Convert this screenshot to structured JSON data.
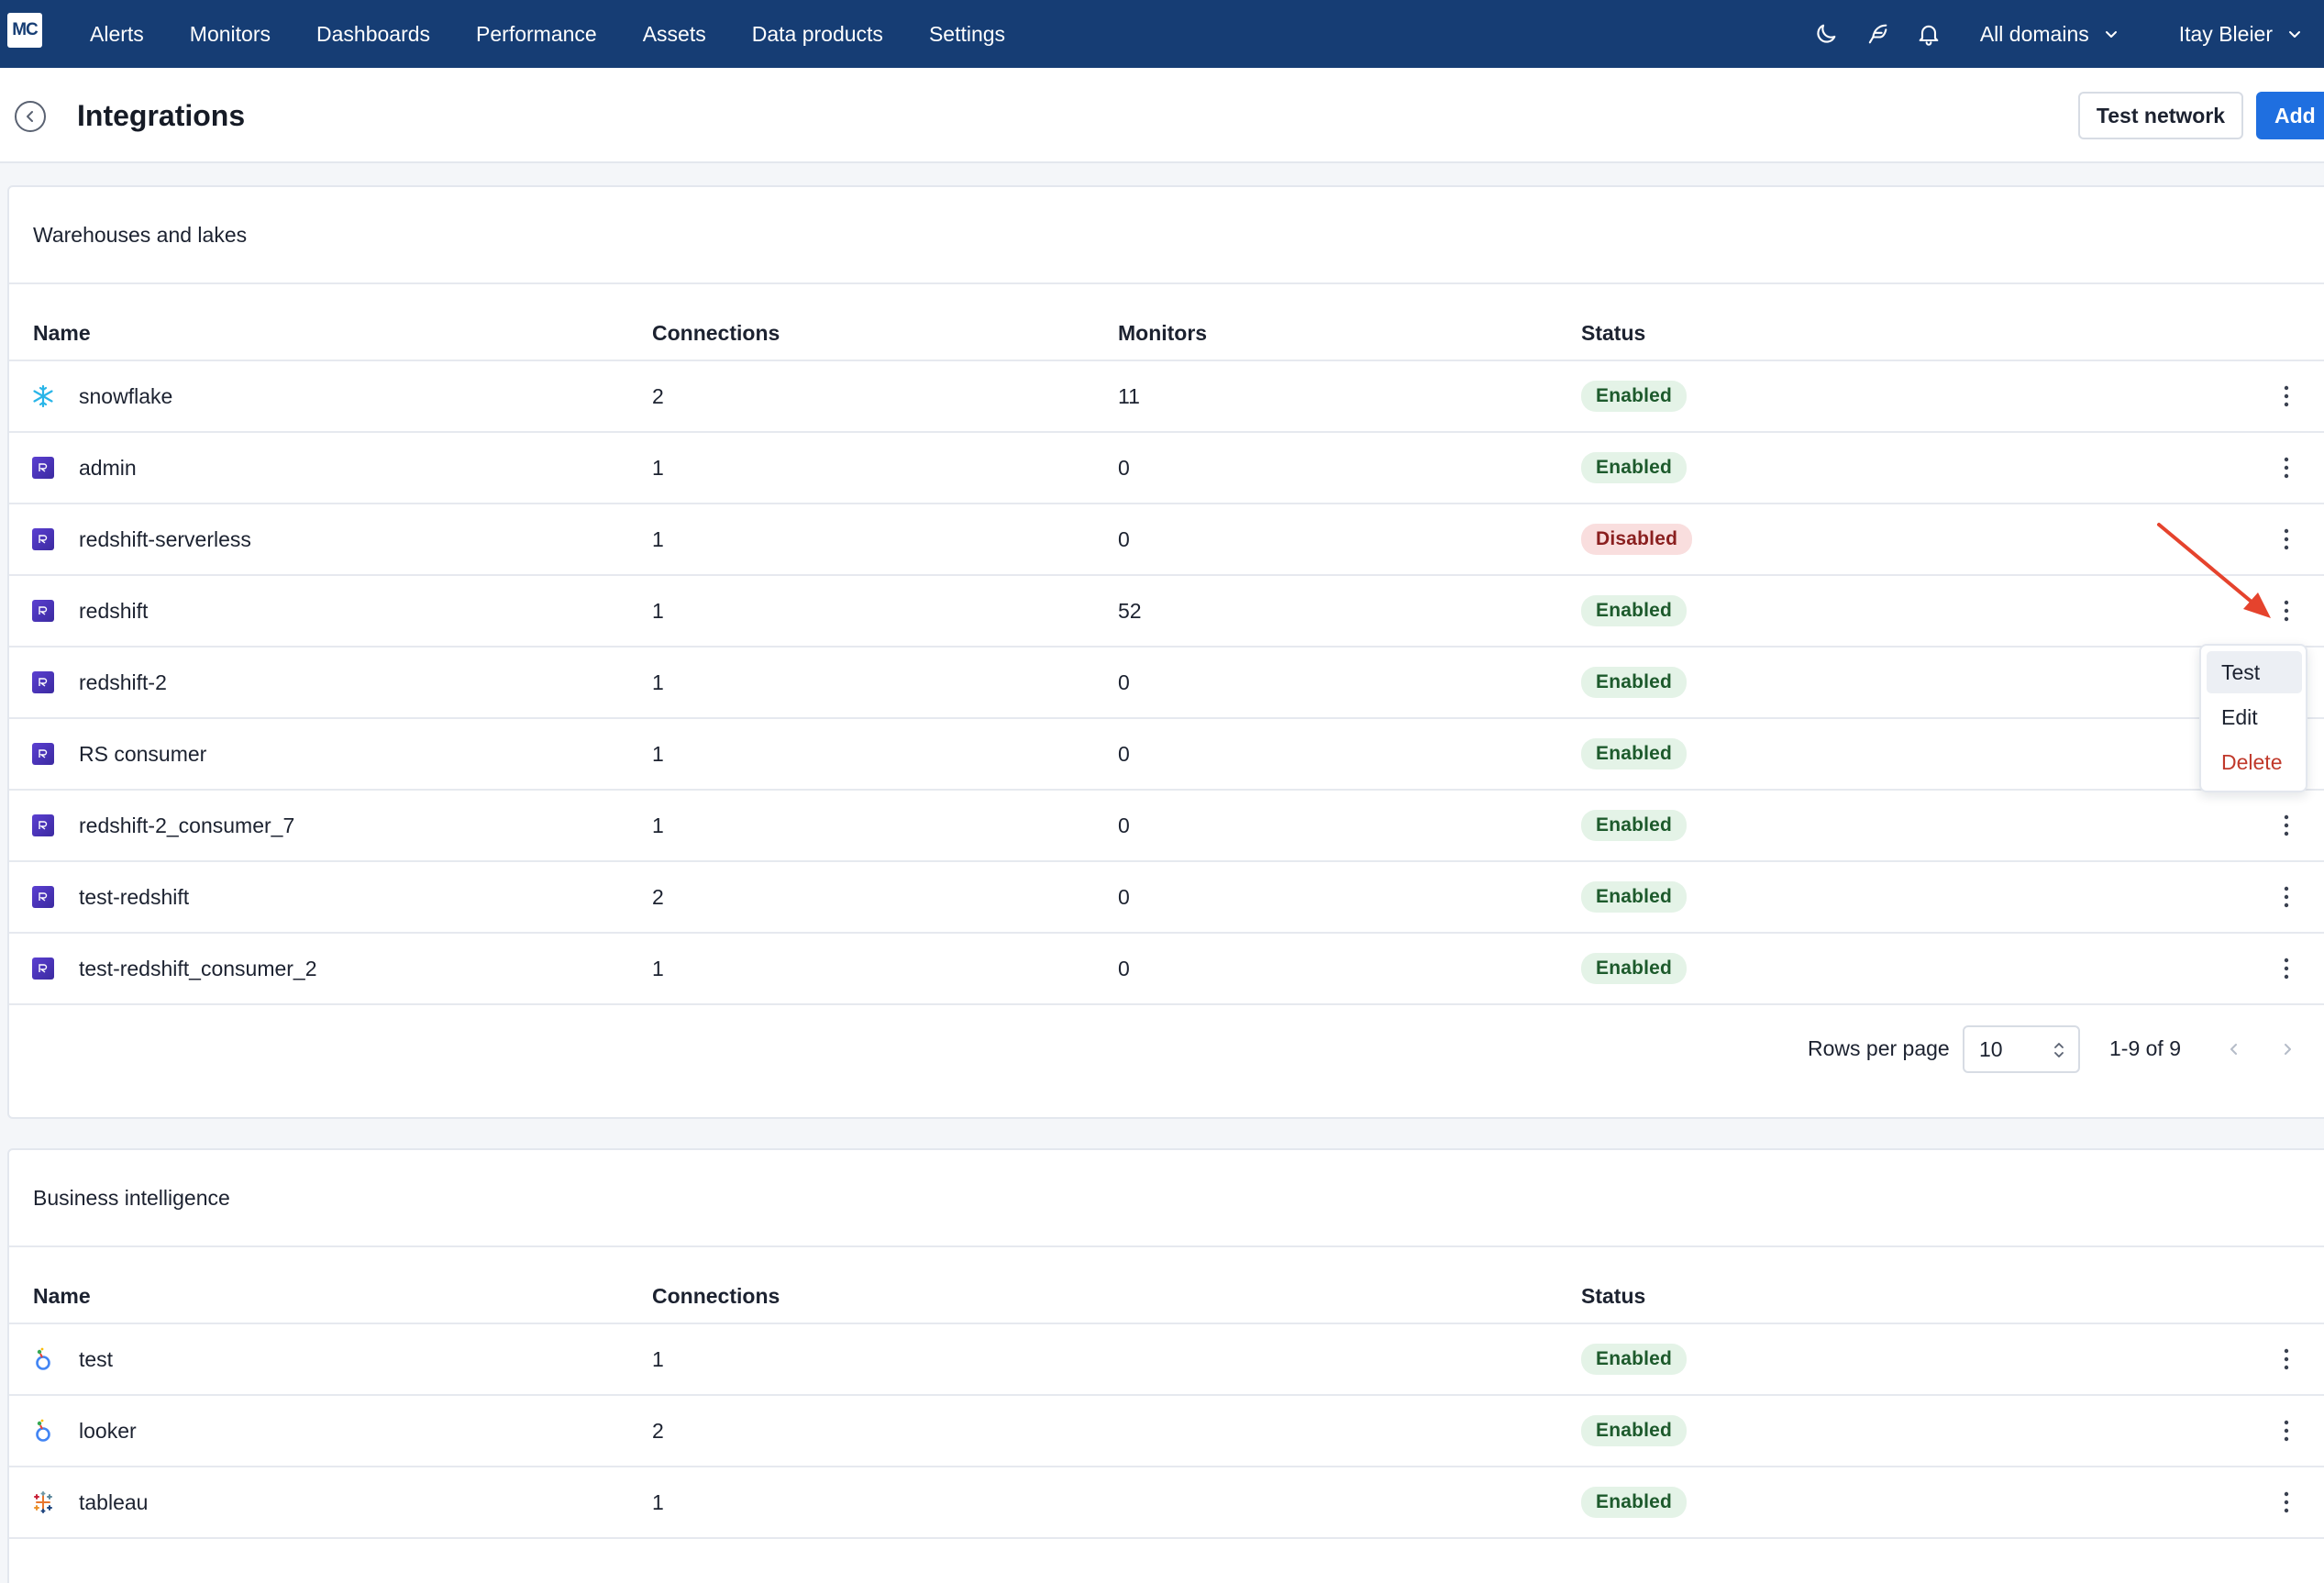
{
  "nav": {
    "logo": "MC",
    "items": [
      "Alerts",
      "Monitors",
      "Dashboards",
      "Performance",
      "Assets",
      "Data products",
      "Settings"
    ],
    "icons": [
      "moon-icon",
      "feather-icon",
      "bell-icon"
    ],
    "domain_select": "All domains",
    "user": "Itay Bleier"
  },
  "header": {
    "title": "Integrations",
    "test_network_label": "Test network",
    "add_label": "Add"
  },
  "warehouses": {
    "title": "Warehouses and lakes",
    "columns": [
      "Name",
      "Connections",
      "Monitors",
      "Status"
    ],
    "rows": [
      {
        "name": "snowflake",
        "icon": "snowflake-icon",
        "connections": "2",
        "monitors": "11",
        "status": "Enabled"
      },
      {
        "name": "admin",
        "icon": "redshift-icon",
        "connections": "1",
        "monitors": "0",
        "status": "Enabled"
      },
      {
        "name": "redshift-serverless",
        "icon": "redshift-icon",
        "connections": "1",
        "monitors": "0",
        "status": "Disabled"
      },
      {
        "name": "redshift",
        "icon": "redshift-icon",
        "connections": "1",
        "monitors": "52",
        "status": "Enabled"
      },
      {
        "name": "redshift-2",
        "icon": "redshift-icon",
        "connections": "1",
        "monitors": "0",
        "status": "Enabled"
      },
      {
        "name": "RS consumer",
        "icon": "redshift-icon",
        "connections": "1",
        "monitors": "0",
        "status": "Enabled"
      },
      {
        "name": "redshift-2_consumer_7",
        "icon": "redshift-icon",
        "connections": "1",
        "monitors": "0",
        "status": "Enabled"
      },
      {
        "name": "test-redshift",
        "icon": "redshift-icon",
        "connections": "2",
        "monitors": "0",
        "status": "Enabled"
      },
      {
        "name": "test-redshift_consumer_2",
        "icon": "redshift-icon",
        "connections": "1",
        "monitors": "0",
        "status": "Enabled"
      }
    ],
    "pagination": {
      "rows_per_page_label": "Rows per page",
      "rows_per_page": "10",
      "range": "1-9 of 9"
    }
  },
  "row_menu": {
    "items": [
      "Test",
      "Edit",
      "Delete"
    ],
    "delete_color": "#c0392b"
  },
  "bi": {
    "title": "Business intelligence",
    "columns": [
      "Name",
      "Connections",
      "Status"
    ],
    "rows": [
      {
        "name": "test",
        "icon": "looker-icon",
        "connections": "1",
        "status": "Enabled"
      },
      {
        "name": "looker",
        "icon": "looker-icon",
        "connections": "2",
        "status": "Enabled"
      },
      {
        "name": "tableau",
        "icon": "tableau-icon",
        "connections": "1",
        "status": "Enabled"
      }
    ]
  },
  "colors": {
    "nav_bg": "#163d74",
    "primary": "#1f6fe0",
    "enabled_bg": "#e4f3e7",
    "disabled_bg": "#f9dede",
    "annotation_arrow": "#e5432d"
  }
}
